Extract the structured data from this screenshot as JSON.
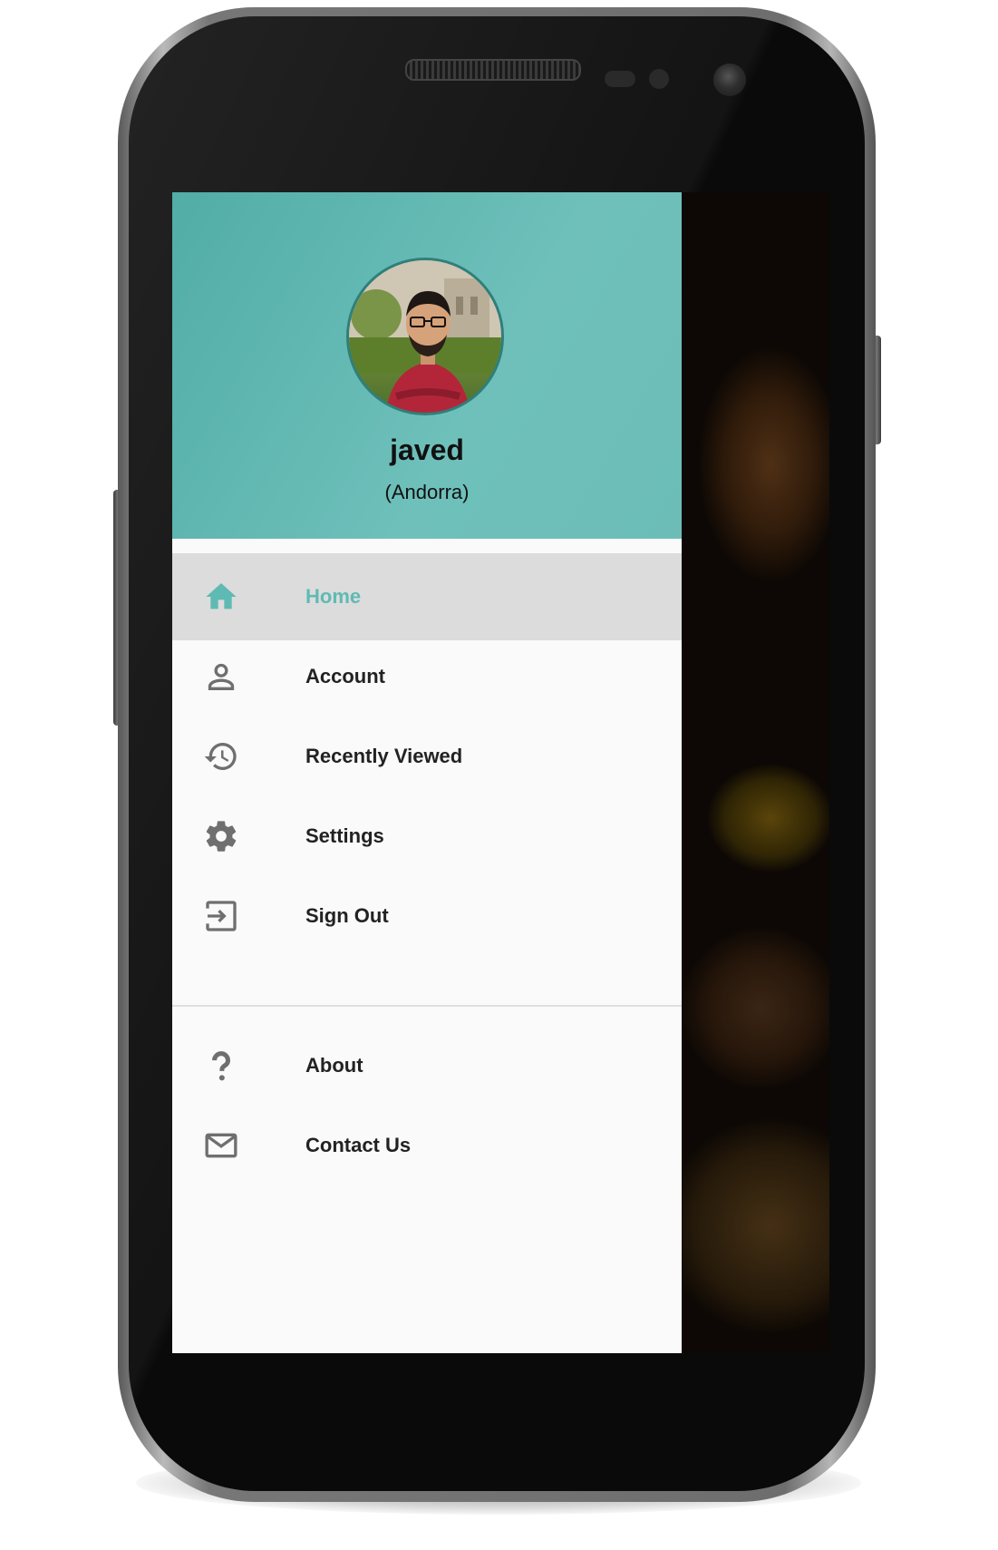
{
  "colors": {
    "header_teal": "#62b8b2",
    "active_accent": "#5fbab3",
    "active_row_bg": "#dcdcdc",
    "drawer_bg": "#fafafa",
    "icon_gray": "#6f6f6f"
  },
  "profile": {
    "name": "javed",
    "country": "(Andorra)",
    "avatar_icon": "profile-photo"
  },
  "menu": {
    "primary": [
      {
        "label": "Home",
        "icon": "home-icon",
        "active": true
      },
      {
        "label": "Account",
        "icon": "person-icon",
        "active": false
      },
      {
        "label": "Recently Viewed",
        "icon": "history-icon",
        "active": false
      },
      {
        "label": "Settings",
        "icon": "gear-icon",
        "active": false
      },
      {
        "label": "Sign Out",
        "icon": "sign-out-icon",
        "active": false
      }
    ],
    "secondary": [
      {
        "label": "About",
        "icon": "question-icon"
      },
      {
        "label": "Contact Us",
        "icon": "mail-icon"
      }
    ]
  }
}
